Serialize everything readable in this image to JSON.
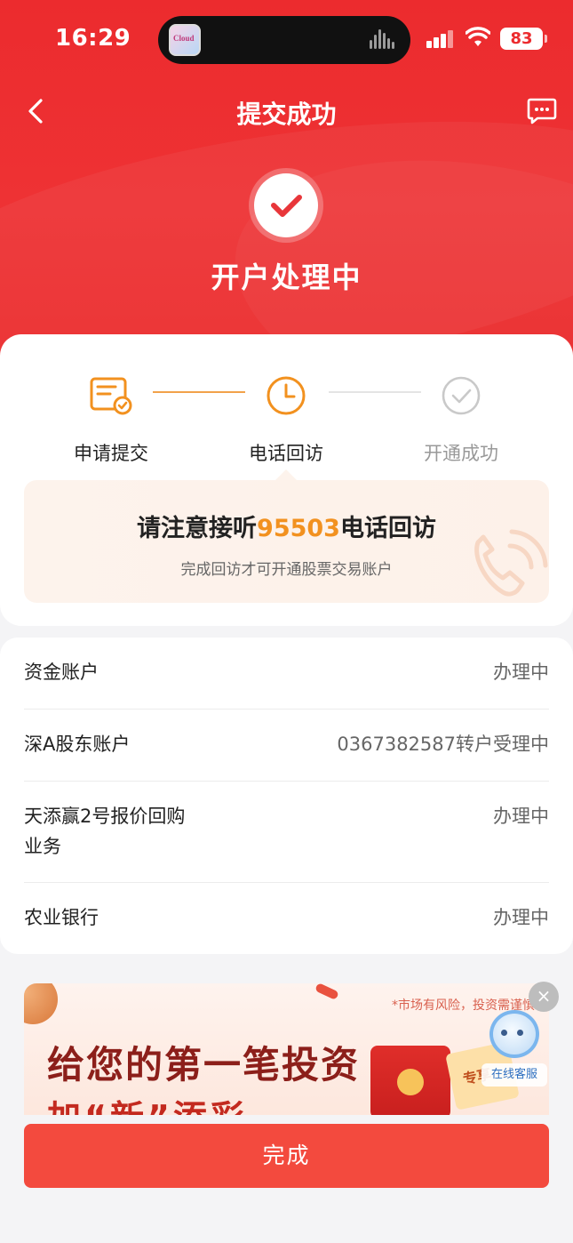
{
  "status_bar": {
    "time": "16:29",
    "battery": "83",
    "app_icon_text": "Cloud"
  },
  "nav": {
    "title": "提交成功"
  },
  "hero": {
    "status": "开户处理中"
  },
  "steps": [
    {
      "label": "申请提交"
    },
    {
      "label": "电话回访"
    },
    {
      "label": "开通成功"
    }
  ],
  "notice": {
    "prefix": "请注意接听",
    "number": "95503",
    "suffix": "电话回访",
    "subtitle": "完成回访才可开通股票交易账户"
  },
  "details": [
    {
      "key": "资金账户",
      "value": "办理中"
    },
    {
      "key": "深A股东账户",
      "value": "0367382587转户受理中"
    },
    {
      "key": "天添赢2号报价回购业务",
      "value": "办理中"
    },
    {
      "key": "农业银行",
      "value": "办理中"
    }
  ],
  "banner": {
    "disclaimer": "*市场有风险，投资需谨慎",
    "headline": "给您的第一笔投资",
    "subheadline": "加“新”添彩",
    "coupon_text": "专享",
    "close": "×"
  },
  "service": {
    "label": "在线客服"
  },
  "footer": {
    "done_label": "完成"
  },
  "colors": {
    "brand_red": "#ec2b2e",
    "accent_orange": "#f2911f",
    "button_red": "#f34a3e"
  }
}
